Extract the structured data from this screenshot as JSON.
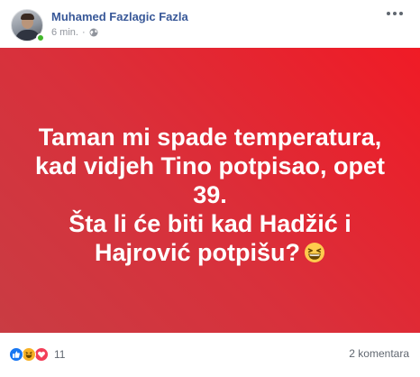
{
  "post": {
    "author": "Muhamed Fazlagic Fazla",
    "time": "6 min.",
    "separator": "·",
    "privacy_icon": "globe-icon",
    "menu_icon": "more-icon",
    "online": true,
    "background": {
      "style": "gradient",
      "from": "#c93c43",
      "to": "#f01b26",
      "text_color": "#ffffff"
    },
    "text_lines": [
      "Taman mi spade temperatura,",
      "kad vidjeh Tino potpisao, opet",
      "39.",
      "Šta li će biti kad Hadžić i",
      "Hajrović potpišu?"
    ],
    "emoji": "grinning-squinting-face"
  },
  "footer": {
    "reactions": [
      "like",
      "haha",
      "love"
    ],
    "reaction_count": "11",
    "comments": "2 komentara"
  },
  "colors": {
    "link": "#385898",
    "meta": "#90949c",
    "online": "#42b72a"
  }
}
